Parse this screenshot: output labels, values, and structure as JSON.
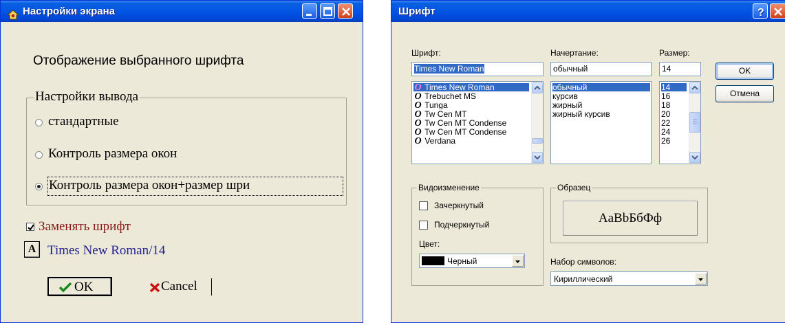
{
  "left_window": {
    "title": "Настройки экрана",
    "heading": "Отображение выбранного шрифта",
    "output_group": {
      "legend": "Настройки вывода",
      "options": [
        {
          "label": "стандартные",
          "selected": false
        },
        {
          "label": "Контроль размера окон",
          "selected": false
        },
        {
          "label": "Контроль размера окон+размер шри",
          "selected": true
        }
      ]
    },
    "replace_font": {
      "label": "Заменять шрифт",
      "checked": true
    },
    "font_icon_glyph": "A",
    "current_font": "Times New Roman/14",
    "ok_label": "OK",
    "cancel_label": "Cancel",
    "colors": {
      "replace_label": "#8b1a1a",
      "font_text": "#1f1f8f",
      "ok_check": "#1a8a1a",
      "cancel_x": "#cc1010"
    }
  },
  "right_window": {
    "title": "Шрифт",
    "font_label": "Шрифт:",
    "font_value": "Times New Roman",
    "font_list": [
      "Times New Roman",
      "Trebuchet MS",
      "Tunga",
      "Tw Cen MT",
      "Tw Cen MT Condense",
      "Tw Cen MT Condense",
      "Verdana"
    ],
    "font_glyph": "O",
    "style_label": "Начертание:",
    "style_value": "обычный",
    "style_list": [
      "обычный",
      "курсив",
      "жирный",
      "жирный курсив"
    ],
    "size_label": "Размер:",
    "size_value": "14",
    "size_list": [
      "14",
      "16",
      "18",
      "20",
      "22",
      "24",
      "26"
    ],
    "ok_label": "OK",
    "cancel_label": "Отмена",
    "effects_legend": "Видоизменение",
    "strikeout_label": "Зачеркнутый",
    "underline_label": "Подчеркнутый",
    "color_label": "Цвет:",
    "color_value": "Черный",
    "sample_legend": "Образец",
    "sample_text": "AaBbБбФф",
    "charset_label": "Набор символов:",
    "charset_value": "Кириллический"
  }
}
